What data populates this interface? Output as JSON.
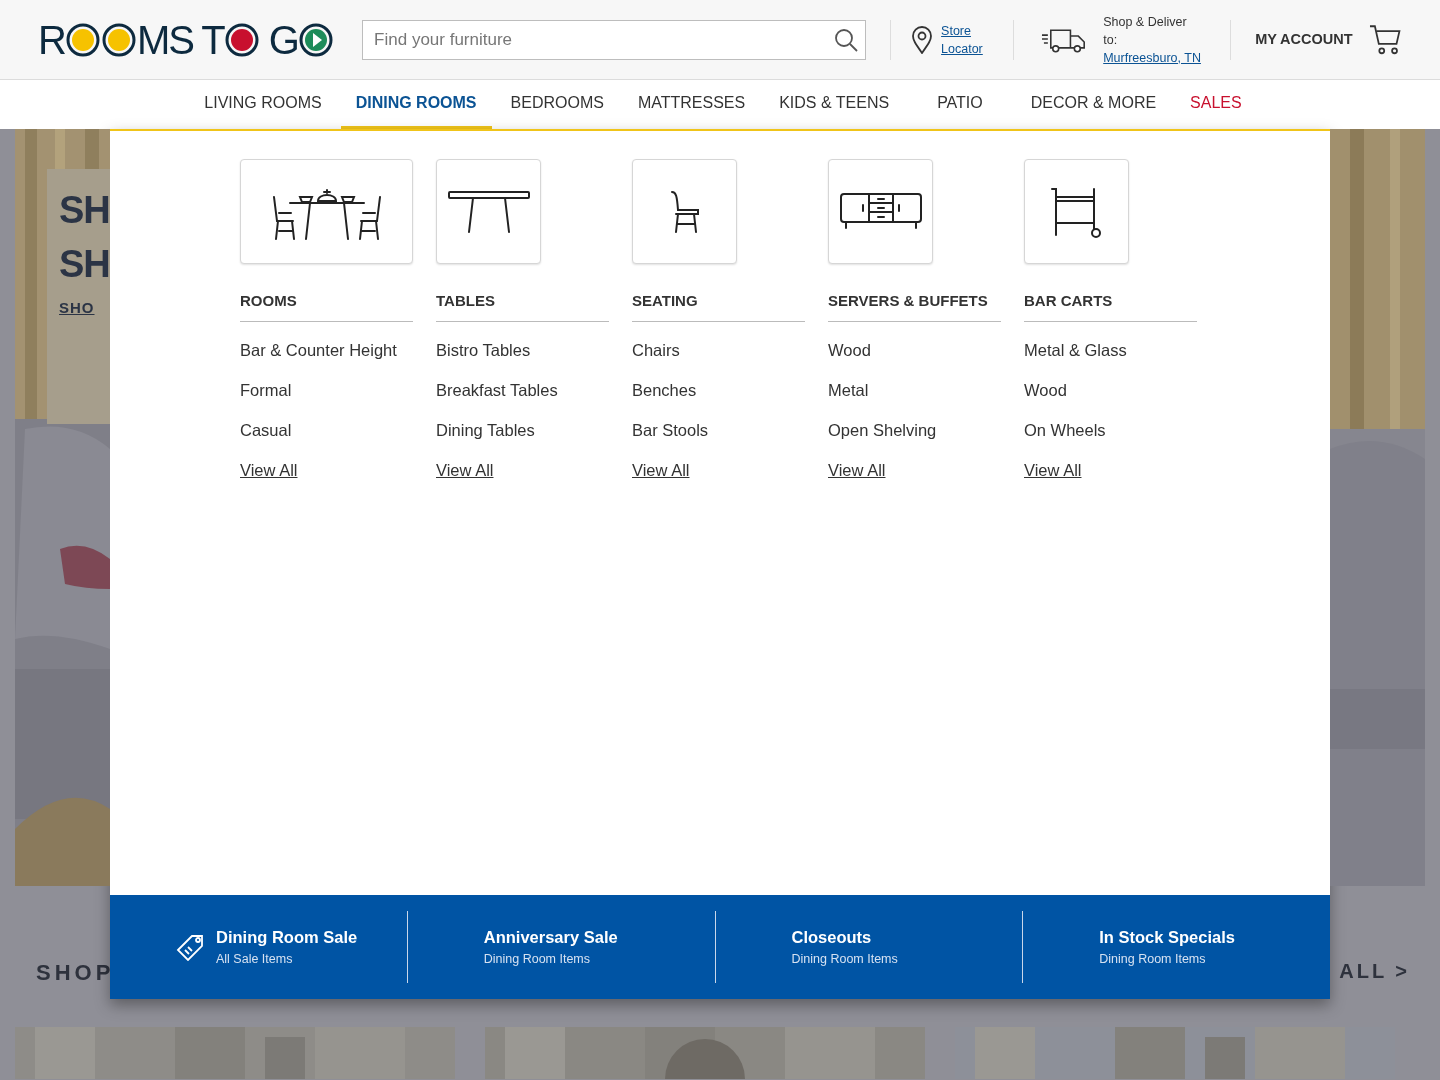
{
  "logo": {
    "parts": [
      {
        "kind": "text",
        "text": "R"
      },
      {
        "kind": "dot",
        "color": "#f6c200"
      },
      {
        "kind": "dot",
        "color": "#f6c200"
      },
      {
        "kind": "text",
        "text": "MS T"
      },
      {
        "kind": "dot",
        "color": "#c8102e"
      },
      {
        "kind": "text",
        "text": " G"
      },
      {
        "kind": "play",
        "color": "#1e8c5a"
      }
    ]
  },
  "search": {
    "placeholder": "Find your furniture"
  },
  "store_locator": "Store Locator",
  "delivery": {
    "label": "Shop & Deliver to:",
    "location": "Murfreesburo, TN"
  },
  "account": "MY ACCOUNT",
  "nav": [
    {
      "label": "LIVING ROOMS",
      "kind": "category",
      "selected": false
    },
    {
      "label": "DINING ROOMS",
      "kind": "category",
      "selected": true
    },
    {
      "label": "BEDROOMS",
      "kind": "category",
      "selected": false
    },
    {
      "label": "MATTRESSES",
      "kind": "category",
      "selected": false
    },
    {
      "label": "KIDS & TEENS",
      "kind": "category",
      "selected": false
    },
    {
      "label": "PATIO",
      "kind": "category",
      "selected": false
    },
    {
      "label": "DECOR & MORE",
      "kind": "category",
      "selected": false
    },
    {
      "label": "SALES",
      "kind": "sale",
      "selected": false
    }
  ],
  "hero": {
    "lines": [
      "SH",
      "SH"
    ],
    "link": "SHO"
  },
  "background_texts": {
    "left": "SHOP",
    "right": "ALL >"
  },
  "menu_columns": [
    {
      "kind": "dining-set",
      "heading": "ROOMS",
      "links": [
        "Bar & Counter Height",
        "Formal",
        "Casual"
      ],
      "view_all": "View All"
    },
    {
      "kind": "table",
      "heading": "TABLES",
      "links": [
        "Bistro Tables",
        "Breakfast Tables",
        "Dining Tables"
      ],
      "view_all": "View All"
    },
    {
      "kind": "chair",
      "heading": "SEATING",
      "links": [
        "Chairs",
        "Benches",
        "Bar Stools"
      ],
      "view_all": "View All"
    },
    {
      "kind": "buffet",
      "heading": "SERVERS & BUFFETS",
      "links": [
        "Wood",
        "Metal",
        "Open Shelving"
      ],
      "view_all": "View All"
    },
    {
      "kind": "cart",
      "heading": "BAR CARTS",
      "links": [
        "Metal & Glass",
        "Wood",
        "On Wheels"
      ],
      "view_all": "View All"
    }
  ],
  "promos": [
    {
      "title": "Dining Room Sale",
      "subtitle": "All Sale Items",
      "tag_icon": true
    },
    {
      "title": "Anniversary Sale",
      "subtitle": "Dining Room Items",
      "tag_icon": false
    },
    {
      "title": "Closeouts",
      "subtitle": "Dining Room Items",
      "tag_icon": false
    },
    {
      "title": "In Stock Specials",
      "subtitle": "Dining Room Items",
      "tag_icon": false
    }
  ]
}
